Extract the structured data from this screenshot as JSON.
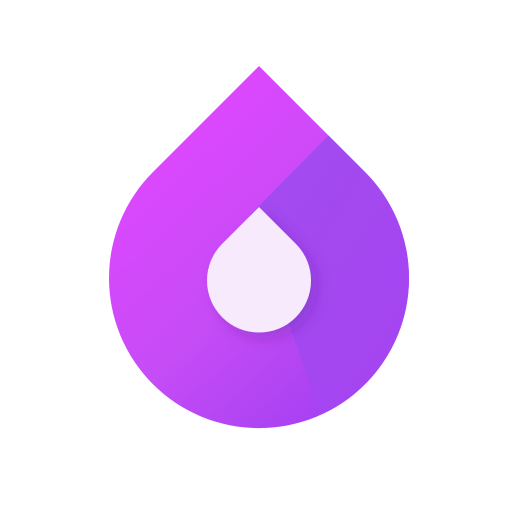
{
  "logo": {
    "icon_name": "drop-icon",
    "colors": {
      "background": "#ffffff",
      "drop_gradient_start": "#e046ff",
      "drop_gradient_mid": "#c64cf6",
      "drop_gradient_end": "#a540f2",
      "fold_panel": "#a24cf0",
      "inner_drop": "#f7eafd"
    }
  }
}
